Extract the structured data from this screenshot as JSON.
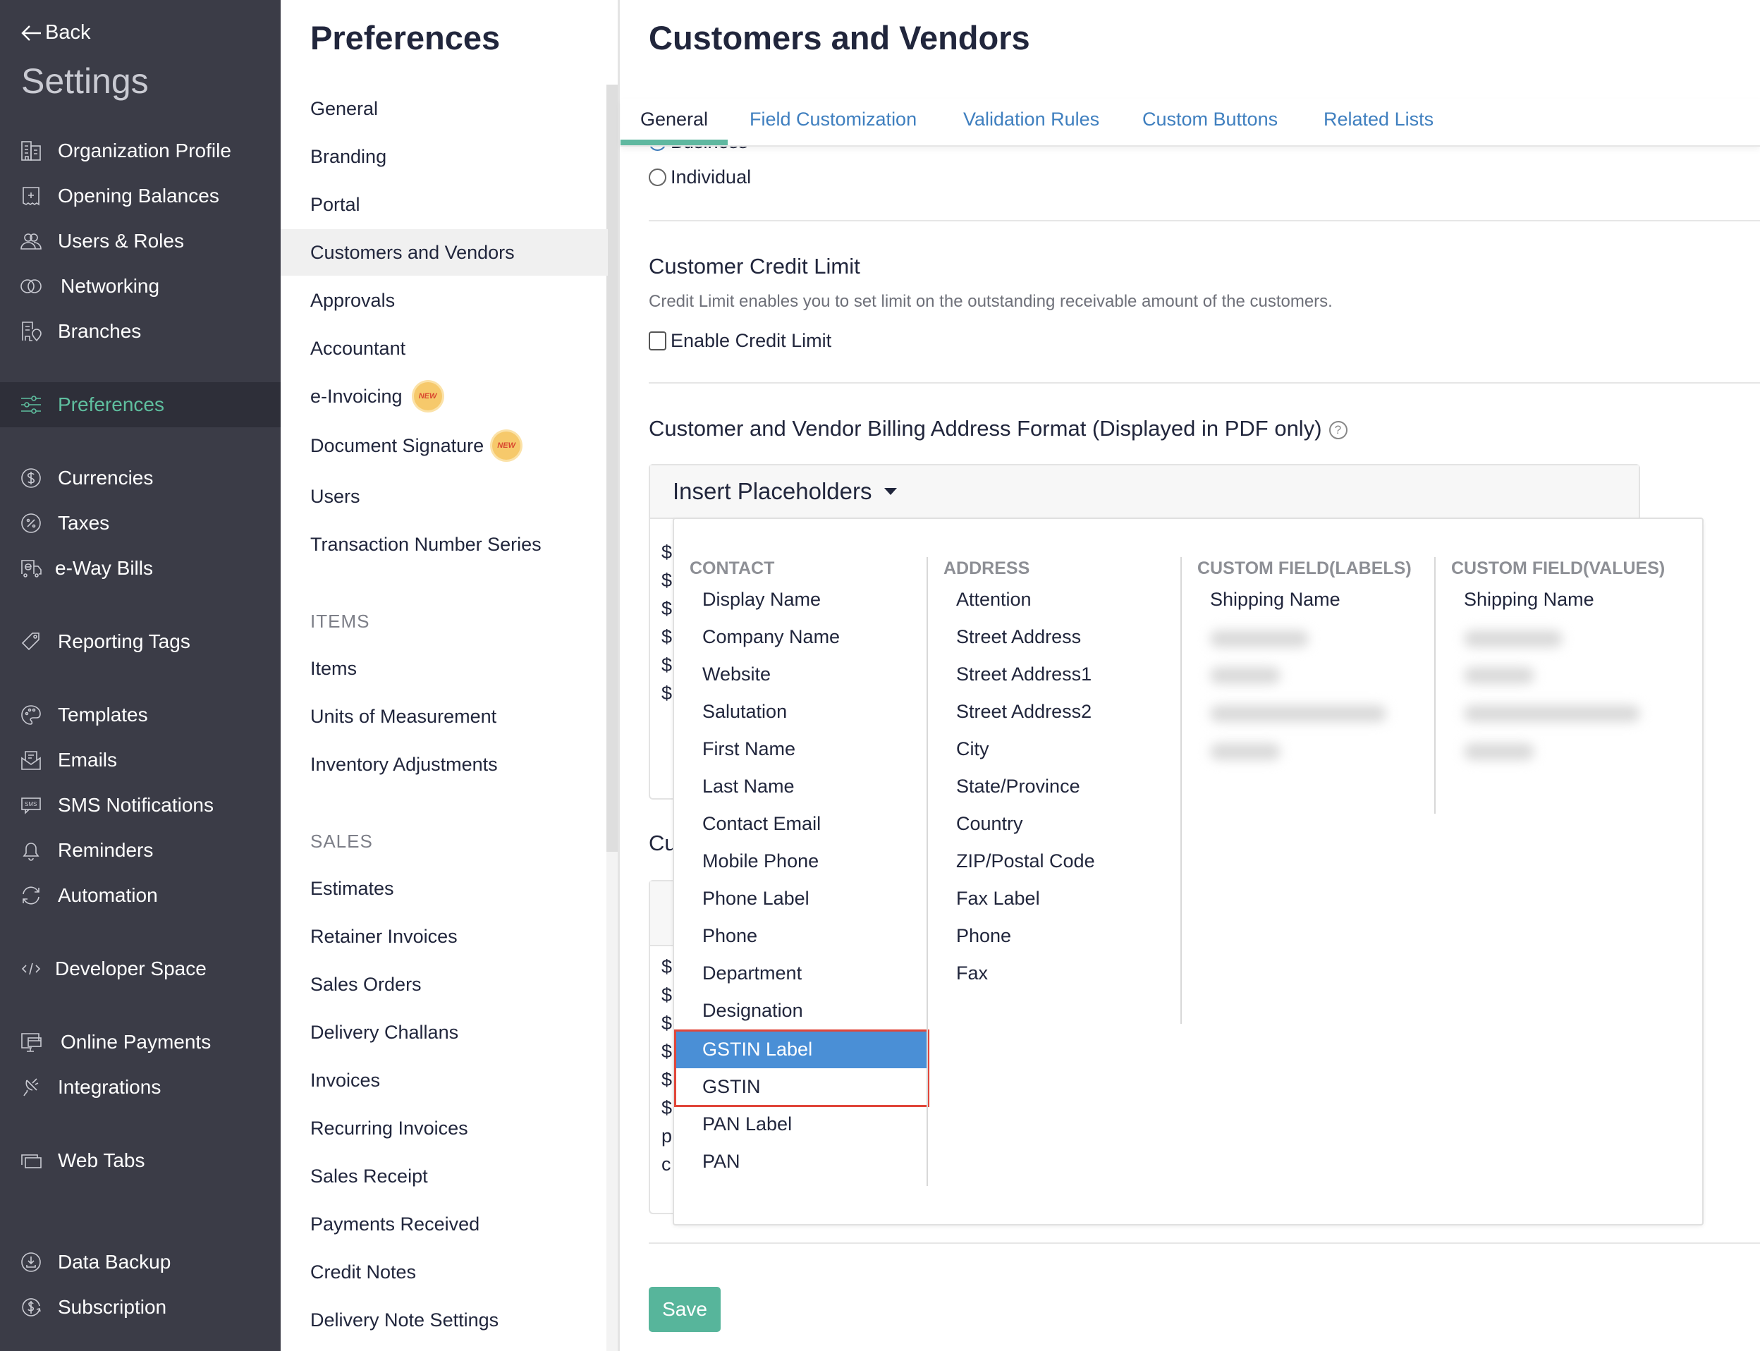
{
  "sidebar": {
    "back_label": "Back",
    "title": "Settings",
    "items": [
      {
        "label": "Organization Profile",
        "icon": "building-icon"
      },
      {
        "label": "Opening Balances",
        "icon": "receipt-icon"
      },
      {
        "label": "Users & Roles",
        "icon": "users-icon"
      },
      {
        "label": "Networking",
        "icon": "rings-icon"
      },
      {
        "label": "Branches",
        "icon": "branch-location-icon"
      },
      {
        "label": "Preferences",
        "icon": "sliders-icon",
        "active": true
      },
      {
        "label": "Currencies",
        "icon": "dollar-circle-icon"
      },
      {
        "label": "Taxes",
        "icon": "percent-circle-icon"
      },
      {
        "label": "e-Way Bills",
        "icon": "truck-e-icon"
      },
      {
        "label": "Reporting Tags",
        "icon": "tag-icon"
      },
      {
        "label": "Templates",
        "icon": "palette-icon"
      },
      {
        "label": "Emails",
        "icon": "envelope-icon"
      },
      {
        "label": "SMS Notifications",
        "icon": "sms-icon"
      },
      {
        "label": "Reminders",
        "icon": "bell-icon"
      },
      {
        "label": "Automation",
        "icon": "refresh-icon"
      },
      {
        "label": "Developer Space",
        "icon": "code-icon"
      },
      {
        "label": "Online Payments",
        "icon": "monitor-card-icon"
      },
      {
        "label": "Integrations",
        "icon": "satellite-icon"
      },
      {
        "label": "Web Tabs",
        "icon": "tabs-icon"
      },
      {
        "label": "Data Backup",
        "icon": "download-circle-icon"
      },
      {
        "label": "Subscription",
        "icon": "subscription-icon"
      }
    ]
  },
  "preferences": {
    "title": "Preferences",
    "items": [
      {
        "label": "General"
      },
      {
        "label": "Branding"
      },
      {
        "label": "Portal"
      },
      {
        "label": "Customers and Vendors",
        "active": true
      },
      {
        "label": "Approvals"
      },
      {
        "label": "Accountant"
      },
      {
        "label": "e-Invoicing",
        "badge": "NEW"
      },
      {
        "label": "Document Signature",
        "badge": "NEW"
      },
      {
        "label": "Users"
      },
      {
        "label": "Transaction Number Series"
      }
    ],
    "sections": [
      {
        "heading": "ITEMS",
        "items": [
          "Items",
          "Units of Measurement",
          "Inventory Adjustments"
        ]
      },
      {
        "heading": "SALES",
        "items": [
          "Estimates",
          "Retainer Invoices",
          "Sales Orders",
          "Delivery Challans",
          "Invoices",
          "Recurring Invoices",
          "Sales Receipt",
          "Payments Received",
          "Credit Notes",
          "Delivery Note Settings"
        ]
      }
    ]
  },
  "main": {
    "title": "Customers and Vendors",
    "tabs": [
      {
        "label": "General",
        "active": true
      },
      {
        "label": "Field Customization"
      },
      {
        "label": "Validation Rules"
      },
      {
        "label": "Custom Buttons"
      },
      {
        "label": "Related Lists"
      }
    ],
    "customer_type": {
      "options": [
        "Business",
        "Individual"
      ]
    },
    "credit_limit": {
      "title": "Customer Credit Limit",
      "description": "Credit Limit enables you to set limit on the outstanding receivable amount of the customers.",
      "checkbox_label": "Enable Credit Limit",
      "checked": false
    },
    "billing_address": {
      "title": "Customer and Vendor Billing Address Format (Displayed in PDF only)",
      "help_icon": "?",
      "insert_placeholders_label": "Insert Placeholders",
      "visible_line_prefixes": [
        "$",
        "$",
        "$",
        "$",
        "$",
        "$"
      ]
    },
    "second_section": {
      "title_partial": "Cu",
      "visible_line_prefixes": [
        "$",
        "$",
        "$",
        "$",
        "$",
        "$",
        "p",
        "c"
      ]
    },
    "save_label": "Save"
  },
  "placeholder_dropdown": {
    "columns": [
      {
        "heading": "CONTACT",
        "items": [
          "Display Name",
          "Company Name",
          "Website",
          "Salutation",
          "First Name",
          "Last Name",
          "Contact Email",
          "Mobile Phone",
          "Phone Label",
          "Phone",
          "Department",
          "Designation",
          "GSTIN Label",
          "GSTIN",
          "PAN Label",
          "PAN"
        ],
        "highlighted": "GSTIN Label",
        "outlined": [
          "GSTIN Label",
          "GSTIN"
        ]
      },
      {
        "heading": "ADDRESS",
        "items": [
          "Attention",
          "Street Address",
          "Street Address1",
          "Street Address2",
          "City",
          "State/Province",
          "Country",
          "ZIP/Postal Code",
          "Fax Label",
          "Phone",
          "Fax"
        ]
      },
      {
        "heading": "CUSTOM FIELD(LABELS)",
        "items": [
          "Shipping Name"
        ],
        "blurred_count": 4
      },
      {
        "heading": "CUSTOM FIELD(VALUES)",
        "items": [
          "Shipping Name"
        ],
        "blurred_count": 4
      }
    ]
  },
  "colors": {
    "sidebar_bg": "#3b3c47",
    "accent_green": "#5fbf9f",
    "link_blue": "#3f7fbf",
    "highlight_blue": "#4a8fd6",
    "outline_red": "#e0463a",
    "save_green": "#57b59b"
  }
}
